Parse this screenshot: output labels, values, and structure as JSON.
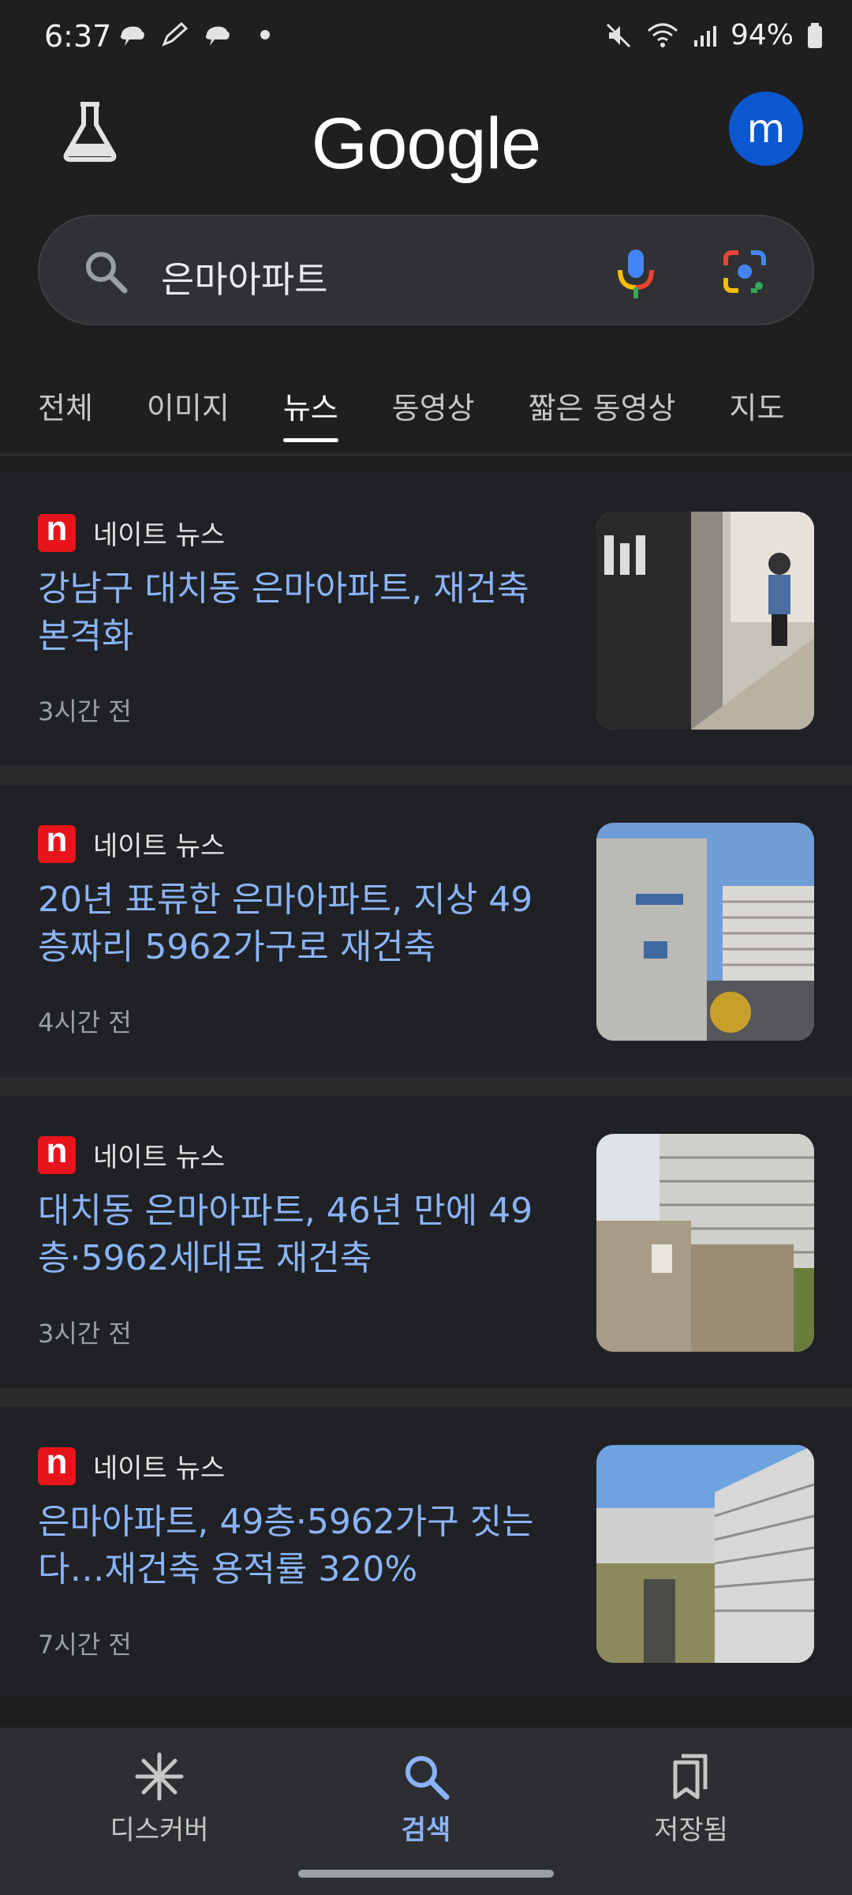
{
  "status": {
    "time": "6:37",
    "battery": "94%"
  },
  "header": {
    "logo": "Google",
    "avatar_letter": "m"
  },
  "search": {
    "query": "은마아파트"
  },
  "tabs": [
    {
      "label": "전체"
    },
    {
      "label": "이미지"
    },
    {
      "label": "뉴스",
      "active": true
    },
    {
      "label": "동영상"
    },
    {
      "label": "짧은 동영상"
    },
    {
      "label": "지도"
    }
  ],
  "news": [
    {
      "source": "네이트 뉴스",
      "title": "강남구 대치동 은마아파트, 재건축 본격화",
      "time": "3시간 전"
    },
    {
      "source": "네이트 뉴스",
      "title": "20년 표류한 은마아파트, 지상 49층짜리 5962가구로 재건축",
      "time": "4시간 전"
    },
    {
      "source": "네이트 뉴스",
      "title": "대치동 은마아파트, 46년 만에 49층·5962세대로 재건축",
      "time": "3시간 전"
    },
    {
      "source": "네이트 뉴스",
      "title": "은마아파트, 49층·5962가구 짓는다…재건축 용적률 320%",
      "time": "7시간 전"
    }
  ],
  "bottom_nav": [
    {
      "label": "디스커버",
      "icon": "asterisk-icon"
    },
    {
      "label": "검색",
      "icon": "search-icon",
      "active": true
    },
    {
      "label": "저장됨",
      "icon": "bookmarks-icon"
    }
  ],
  "colors": {
    "accent": "#8ab4f8",
    "background": "#1f1f1f",
    "avatar": "#0b57d0",
    "source_icon": "#e8141c"
  }
}
